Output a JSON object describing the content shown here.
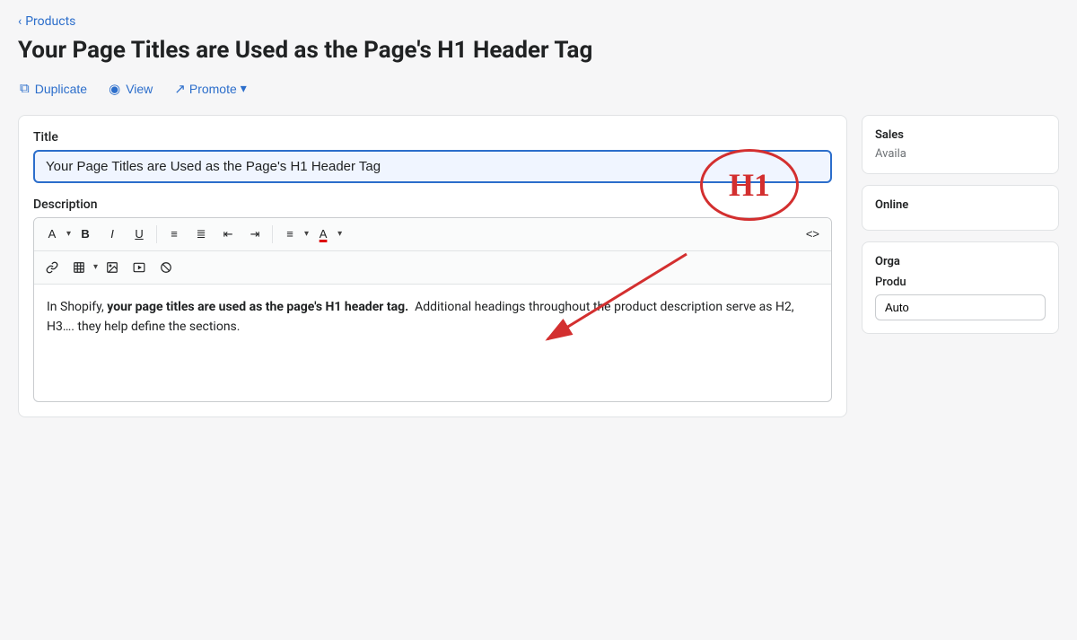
{
  "breadcrumb": {
    "back_label": "Products",
    "chevron": "‹"
  },
  "page": {
    "title": "Your Page Titles are Used as the Page's H1 Header Tag"
  },
  "actions": {
    "duplicate_label": "Duplicate",
    "view_label": "View",
    "promote_label": "Promote"
  },
  "form": {
    "title_label": "Title",
    "title_value": "Your Page Titles are Used as the Page's H1 Header Tag",
    "description_label": "Description",
    "editor_content_html": "In Shopify, <strong>your page titles are used as the page's H1 header tag.</strong>  Additional headings throughout the product description serve as H2, H3…. they help define the sections."
  },
  "toolbar": {
    "row1": [
      {
        "label": "A",
        "has_arrow": true
      },
      {
        "label": "B",
        "bold": true
      },
      {
        "label": "I",
        "italic": true
      },
      {
        "label": "U",
        "underline": true
      },
      {
        "label": "≡",
        "title": "unordered list"
      },
      {
        "label": "≣",
        "title": "ordered list"
      },
      {
        "label": "⇤",
        "title": "outdent"
      },
      {
        "label": "⇥",
        "title": "indent"
      },
      {
        "label": "≡",
        "has_arrow": true,
        "title": "align"
      },
      {
        "label": "A",
        "has_arrow": true,
        "title": "text color"
      },
      {
        "label": "<>",
        "code": true
      }
    ],
    "row2": [
      {
        "label": "🔗",
        "title": "link"
      },
      {
        "label": "⊞",
        "has_arrow": true,
        "title": "table"
      },
      {
        "label": "🖼",
        "title": "image"
      },
      {
        "label": "▶",
        "title": "video"
      },
      {
        "label": "⊘",
        "title": "no format"
      }
    ]
  },
  "right_panel": {
    "sales_title": "Sales",
    "sales_subtitle": "Availa",
    "online_title": "Online",
    "org_title": "Orga",
    "product_label": "Produ",
    "product_value": "Auto"
  },
  "annotation": {
    "h1_label": "H1",
    "circle_color": "#d32f2f",
    "arrow_color": "#d32f2f"
  }
}
